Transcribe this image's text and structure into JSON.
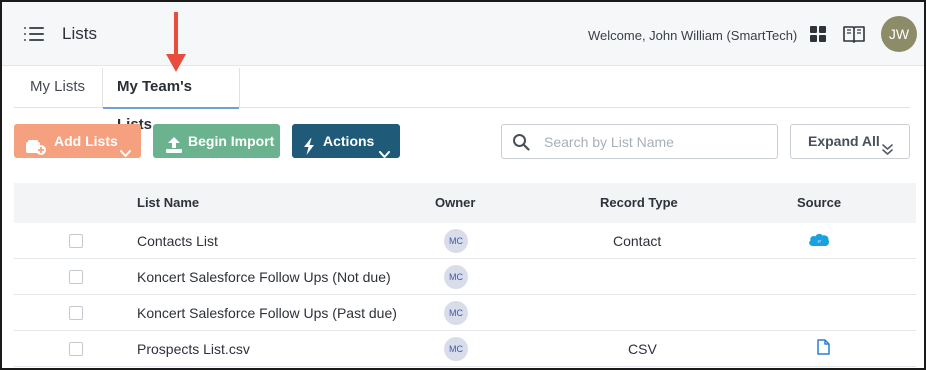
{
  "header": {
    "title": "Lists",
    "welcome": "Welcome, John William (SmartTech)",
    "avatar_initials": "JW"
  },
  "tabs": [
    {
      "label": "My Lists",
      "active": false
    },
    {
      "label": "My Team's Lists",
      "active": true
    }
  ],
  "toolbar": {
    "add_lists_label": "Add Lists",
    "begin_import_label": "Begin Import",
    "actions_label": "Actions",
    "search_placeholder": "Search by List Name",
    "search_value": "",
    "expand_all_label": "Expand All"
  },
  "table": {
    "columns": [
      "List Name",
      "Owner",
      "Record Type",
      "Source"
    ],
    "rows": [
      {
        "name": "Contacts List",
        "owner": "MC",
        "record_type": "Contact",
        "source": "salesforce-icon"
      },
      {
        "name": "Koncert Salesforce Follow Ups (Not due)",
        "owner": "MC",
        "record_type": "",
        "source": ""
      },
      {
        "name": "Koncert Salesforce Follow Ups (Past due)",
        "owner": "MC",
        "record_type": "",
        "source": ""
      },
      {
        "name": "Prospects List.csv",
        "owner": "MC",
        "record_type": "CSV",
        "source": "file-icon"
      }
    ]
  },
  "colors": {
    "add_lists": "#f5a07e",
    "begin_import": "#6bb38f",
    "actions": "#1f5a78",
    "annotation_arrow": "#e74c3c",
    "avatar": "#8c8c68"
  }
}
